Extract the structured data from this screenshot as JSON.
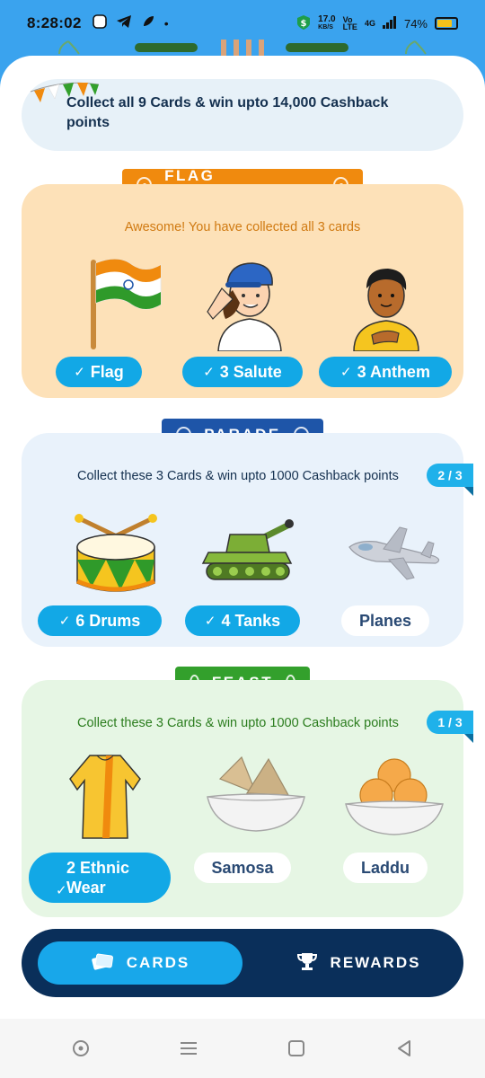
{
  "status_bar": {
    "time": "8:28:02",
    "speed": "17.0",
    "speed_unit": "KB/S",
    "network": "4G",
    "battery": "74%"
  },
  "banner": {
    "text": "Collect all 9 Cards & win upto 14,000 Cashback points"
  },
  "sections": {
    "flag": {
      "title": "FLAG UNFURLING",
      "subtitle": "Awesome! You have collected all 3 cards",
      "cards": [
        {
          "label": "Flag",
          "collected": true,
          "icon": "flag-icon"
        },
        {
          "label": "3 Salute",
          "collected": true,
          "icon": "salute-girl-icon"
        },
        {
          "label": "3 Anthem",
          "collected": true,
          "icon": "anthem-boy-icon"
        }
      ]
    },
    "parade": {
      "title": "PARADE",
      "subtitle": "Collect these 3 Cards & win upto 1000 Cashback points",
      "counter": "2 / 3",
      "cards": [
        {
          "label": "6 Drums",
          "collected": true,
          "icon": "drum-icon"
        },
        {
          "label": "4 Tanks",
          "collected": true,
          "icon": "tank-icon"
        },
        {
          "label": "Planes",
          "collected": false,
          "icon": "plane-icon"
        }
      ]
    },
    "feast": {
      "title": "FEAST",
      "subtitle": "Collect these 3 Cards & win upto 1000 Cashback points",
      "counter": "1 / 3",
      "cards": [
        {
          "label": "2 Ethnic Wear",
          "collected": true,
          "icon": "kurta-icon"
        },
        {
          "label": "Samosa",
          "collected": false,
          "icon": "samosa-icon"
        },
        {
          "label": "Laddu",
          "collected": false,
          "icon": "laddu-icon"
        }
      ]
    }
  },
  "bottom_nav": {
    "cards_label": "CARDS",
    "rewards_label": "REWARDS"
  },
  "colors": {
    "primary_blue": "#18a7ea",
    "navy": "#0a2f5a",
    "saffron": "#f08a0e",
    "green": "#33a02c"
  }
}
